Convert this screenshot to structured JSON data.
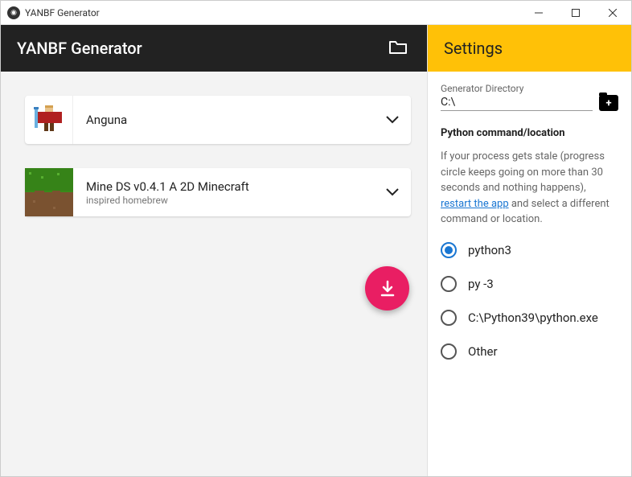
{
  "window": {
    "title": "YANBF Generator"
  },
  "header": {
    "title": "YANBF Generator"
  },
  "items": [
    {
      "title": "Anguna",
      "subtitle": ""
    },
    {
      "title": "Mine DS v0.4.1 A 2D Minecraft",
      "subtitle": "inspired homebrew"
    }
  ],
  "settings": {
    "title": "Settings",
    "dir_label": "Generator Directory",
    "dir_value": "C:\\",
    "python_section": "Python command/location",
    "help_pre": "If your process gets stale (progress circle keeps going on more than 30 seconds and nothing happens), ",
    "help_link": "restart the app",
    "help_post": " and select a different command or location.",
    "options": [
      "python3",
      "py -3",
      "C:\\Python39\\python.exe",
      "Other"
    ],
    "selected": 0
  }
}
